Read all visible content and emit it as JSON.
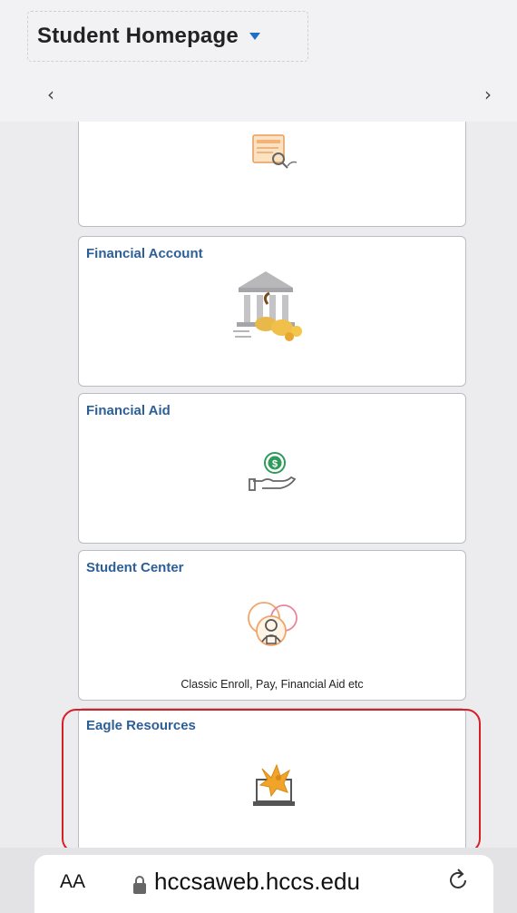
{
  "header": {
    "title": "Student Homepage",
    "prev_arrow": "‹",
    "next_arrow": "›"
  },
  "tiles": [
    {
      "title": "",
      "icon": "document-search-icon",
      "description": ""
    },
    {
      "title": "Financial Account",
      "icon": "bank-coins-icon",
      "description": ""
    },
    {
      "title": "Financial Aid",
      "icon": "hand-dollar-icon",
      "description": ""
    },
    {
      "title": "Student Center",
      "icon": "student-circles-icon",
      "description": "Classic Enroll, Pay, Financial Aid etc"
    },
    {
      "title": "Eagle Resources",
      "icon": "eagle-laptop-icon",
      "description": ""
    }
  ],
  "browser": {
    "text_size_label": "AA",
    "url": "hccsaweb.hccs.edu",
    "lock_icon": "lock-icon",
    "reload_icon": "reload-icon"
  },
  "colors": {
    "tile_title": "#2d5f97",
    "caret": "#1f6fc4",
    "highlight": "#d71f26"
  }
}
